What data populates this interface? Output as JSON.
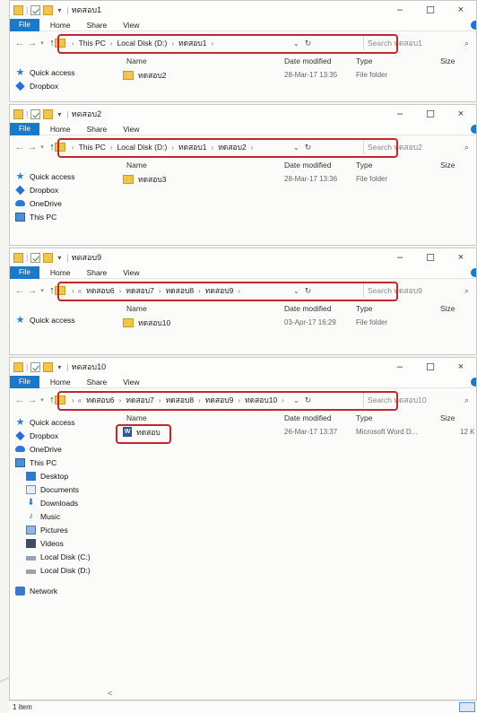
{
  "windows": [
    {
      "title": "ทดสอบ1",
      "address": [
        "This PC",
        "Local Disk (D:)",
        "ทดสอบ1"
      ],
      "search_placeholder": "Search ทดสอบ1",
      "nav_items": [
        {
          "label": "Quick access",
          "icon": "star-icon"
        },
        {
          "label": "Dropbox",
          "icon": "dropbox-icon"
        }
      ],
      "files": [
        {
          "name": "ทดสอบ2",
          "modified": "28-Mar-17 13:35",
          "type": "File folder",
          "size": "",
          "icon": "folder-icon"
        }
      ]
    },
    {
      "title": "ทดสอบ2",
      "address": [
        "This PC",
        "Local Disk (D:)",
        "ทดสอบ1",
        "ทดสอบ2"
      ],
      "search_placeholder": "Search ทดสอบ2",
      "nav_items": [
        {
          "label": "Quick access",
          "icon": "star-icon"
        },
        {
          "label": "Dropbox",
          "icon": "dropbox-icon"
        },
        {
          "label": "OneDrive",
          "icon": "onedrive-icon"
        },
        {
          "label": "This PC",
          "icon": "pc-icon"
        }
      ],
      "files": [
        {
          "name": "ทดสอบ3",
          "modified": "28-Mar-17 13:36",
          "type": "File folder",
          "size": "",
          "icon": "folder-icon"
        }
      ]
    },
    {
      "title": "ทดสอบ9",
      "address_prefix": "«",
      "address": [
        "ทดสอบ6",
        "ทดสอบ7",
        "ทดสอบ8",
        "ทดสอบ9"
      ],
      "search_placeholder": "Search ทดสอบ9",
      "nav_items": [
        {
          "label": "Quick access",
          "icon": "star-icon"
        }
      ],
      "files": [
        {
          "name": "ทดสอบ10",
          "modified": "03-Apr-17 16:29",
          "type": "File folder",
          "size": "",
          "icon": "folder-icon"
        }
      ]
    },
    {
      "title": "ทดสอบ10",
      "address_prefix": "«",
      "address": [
        "ทดสอบ6",
        "ทดสอบ7",
        "ทดสอบ8",
        "ทดสอบ9",
        "ทดสอบ10"
      ],
      "search_placeholder": "Search ทดสอบ10",
      "nav_items": [
        {
          "label": "Quick access",
          "icon": "star-icon"
        },
        {
          "label": "Dropbox",
          "icon": "dropbox-icon"
        },
        {
          "label": "OneDrive",
          "icon": "onedrive-icon"
        },
        {
          "label": "This PC",
          "icon": "pc-icon"
        },
        {
          "label": "Desktop",
          "icon": "desktop-icon",
          "indent": true
        },
        {
          "label": "Documents",
          "icon": "documents-icon",
          "indent": true
        },
        {
          "label": "Downloads",
          "icon": "downloads-icon",
          "indent": true
        },
        {
          "label": "Music",
          "icon": "music-icon",
          "indent": true
        },
        {
          "label": "Pictures",
          "icon": "pictures-icon",
          "indent": true
        },
        {
          "label": "Videos",
          "icon": "videos-icon",
          "indent": true
        },
        {
          "label": "Local Disk (C:)",
          "icon": "local-disk-icon",
          "indent": true
        },
        {
          "label": "Local Disk (D:)",
          "icon": "local-disk-icon",
          "indent": true
        },
        {
          "label": "Network",
          "icon": "network-icon",
          "gap": true
        }
      ],
      "files": [
        {
          "name": "ทดสอบ",
          "modified": "26-Mar-17 13:37",
          "type": "Microsoft Word D...",
          "size": "12 K",
          "icon": "word-doc-icon"
        }
      ]
    }
  ],
  "ribbon_tabs": {
    "file": "File",
    "home": "Home",
    "share": "Share",
    "view": "View"
  },
  "columns": {
    "name": "Name",
    "modified": "Date modified",
    "type": "Type",
    "size": "Size"
  },
  "window_controls": {
    "minimize": "–",
    "maximize": "☐",
    "close": "×"
  },
  "status": {
    "items": "1 item"
  },
  "colors": {
    "accent": "#1979ca",
    "highlight_box": "#c1272d",
    "folder": "#f0c450"
  }
}
